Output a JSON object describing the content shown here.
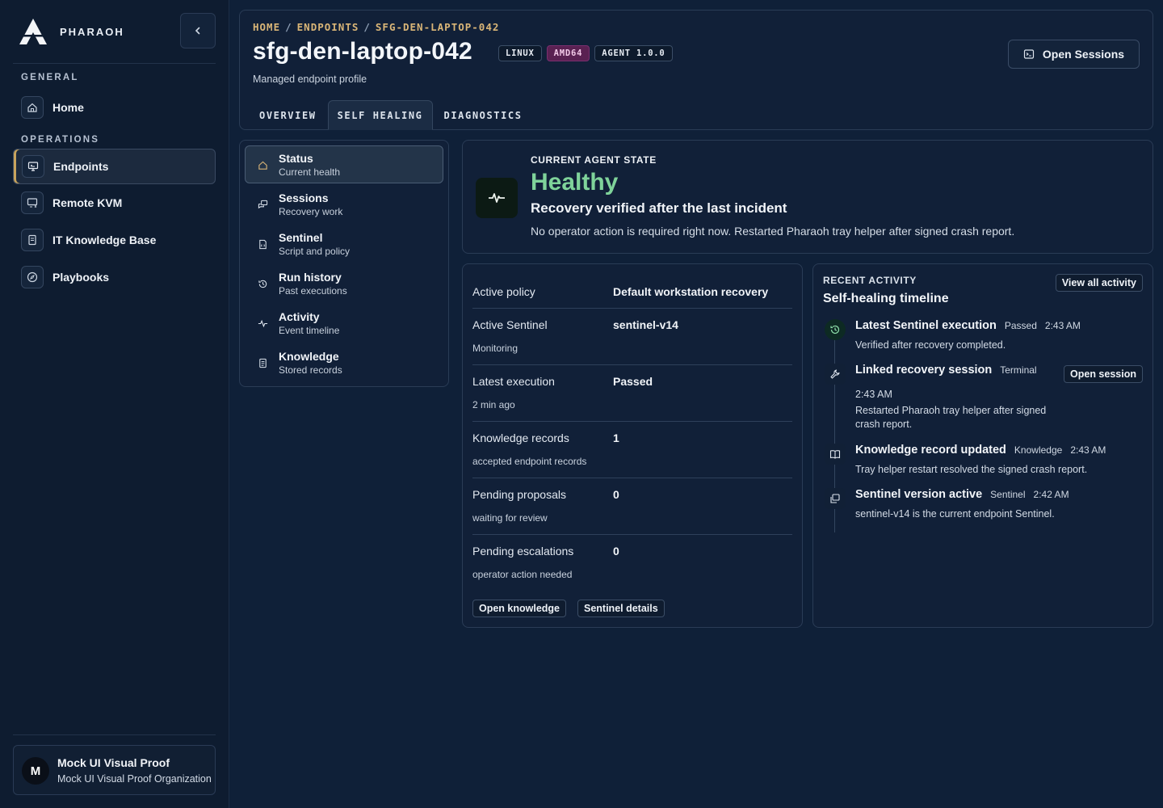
{
  "brand": {
    "name": "PHARAOH"
  },
  "sidebar": {
    "sections": [
      {
        "label": "GENERAL"
      },
      {
        "label": "OPERATIONS"
      }
    ],
    "items": [
      {
        "label": "Home",
        "icon": "home-icon"
      },
      {
        "label": "Endpoints",
        "icon": "monitor-icon"
      },
      {
        "label": "Remote KVM",
        "icon": "remote-display-icon"
      },
      {
        "label": "IT Knowledge Base",
        "icon": "book-icon"
      },
      {
        "label": "Playbooks",
        "icon": "compass-icon"
      }
    ],
    "org": {
      "initial": "M",
      "name": "Mock UI Visual Proof",
      "subtitle": "Mock UI Visual Proof Organization"
    }
  },
  "header": {
    "breadcrumb": [
      "HOME",
      "ENDPOINTS",
      "SFG-DEN-LAPTOP-042"
    ],
    "title": "sfg-den-laptop-042",
    "badges": [
      "LINUX",
      "AMD64",
      "AGENT 1.0.0"
    ],
    "subtitle": "Managed endpoint profile",
    "open_sessions_label": "Open Sessions",
    "tabs": [
      "OVERVIEW",
      "SELF HEALING",
      "DIAGNOSTICS"
    ]
  },
  "subnav": [
    {
      "title": "Status",
      "sub": "Current health"
    },
    {
      "title": "Sessions",
      "sub": "Recovery work"
    },
    {
      "title": "Sentinel",
      "sub": "Script and policy"
    },
    {
      "title": "Run history",
      "sub": "Past executions"
    },
    {
      "title": "Activity",
      "sub": "Event timeline"
    },
    {
      "title": "Knowledge",
      "sub": "Stored records"
    }
  ],
  "status": {
    "label": "CURRENT AGENT STATE",
    "value": "Healthy",
    "headline": "Recovery verified after the last incident",
    "description": "No operator action is required right now. Restarted Pharaoh tray helper after signed crash report.",
    "accent": "#7fd39a"
  },
  "details": {
    "rows": [
      {
        "label": "Active policy",
        "value": "Default workstation recovery",
        "note": ""
      },
      {
        "label": "Active Sentinel",
        "value": "sentinel-v14",
        "note": "Monitoring"
      },
      {
        "label": "Latest execution",
        "value": "Passed",
        "note": "2 min ago"
      },
      {
        "label": "Knowledge records",
        "value": "1",
        "note": "accepted endpoint records"
      },
      {
        "label": "Pending proposals",
        "value": "0",
        "note": "waiting for review"
      },
      {
        "label": "Pending escalations",
        "value": "0",
        "note": "operator action needed"
      }
    ],
    "open_knowledge_label": "Open knowledge",
    "sentinel_details_label": "Sentinel details"
  },
  "activity": {
    "eyebrow": "RECENT ACTIVITY",
    "title": "Self-healing timeline",
    "view_all_label": "View all activity",
    "open_session_label": "Open session",
    "items": [
      {
        "name": "Latest Sentinel execution",
        "tag": "Passed",
        "time": "2:43 AM",
        "desc": "Verified after recovery completed.",
        "icon": "history-icon"
      },
      {
        "name": "Linked recovery session",
        "tag": "Terminal",
        "time": "2:43 AM",
        "desc": "Restarted Pharaoh tray helper after signed crash report.",
        "icon": "wrench-icon"
      },
      {
        "name": "Knowledge record updated",
        "tag": "Knowledge",
        "time": "2:43 AM",
        "desc": "Tray helper restart resolved the signed crash report.",
        "icon": "open-book-icon"
      },
      {
        "name": "Sentinel version active",
        "tag": "Sentinel",
        "time": "2:42 AM",
        "desc": "sentinel-v14 is the current endpoint Sentinel.",
        "icon": "device-icon"
      }
    ]
  }
}
